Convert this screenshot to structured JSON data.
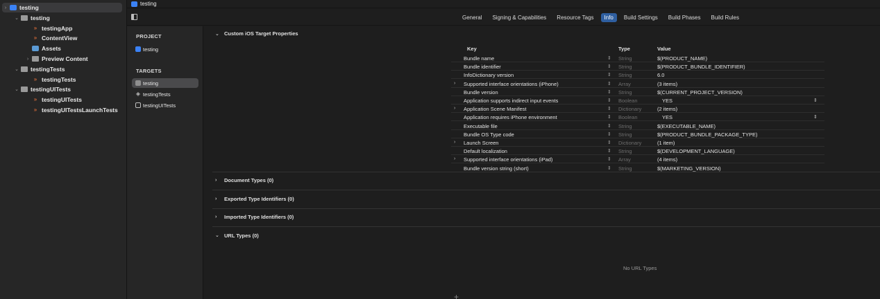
{
  "navigator": {
    "items": [
      {
        "label": "testing",
        "chevron": "›",
        "icon": "project-icon",
        "indent": 0,
        "selected": true
      },
      {
        "label": "testing",
        "chevron": "⌄",
        "icon": "folder-icon",
        "indent": 1
      },
      {
        "label": "testingApp",
        "chevron": "",
        "icon": "swift-file-icon",
        "indent": 2
      },
      {
        "label": "ContentView",
        "chevron": "",
        "icon": "swift-file-icon",
        "indent": 2
      },
      {
        "label": "Assets",
        "chevron": "",
        "icon": "asset-catalog-icon",
        "indent": 2
      },
      {
        "label": "Preview Content",
        "chevron": "›",
        "icon": "folder-icon",
        "indent": 2
      },
      {
        "label": "testingTests",
        "chevron": "⌄",
        "icon": "folder-icon",
        "indent": 1
      },
      {
        "label": "testingTests",
        "chevron": "",
        "icon": "swift-file-icon",
        "indent": 2
      },
      {
        "label": "testingUITests",
        "chevron": "⌄",
        "icon": "folder-icon",
        "indent": 1
      },
      {
        "label": "testingUITests",
        "chevron": "",
        "icon": "swift-file-icon",
        "indent": 2
      },
      {
        "label": "testingUITestsLaunchTests",
        "chevron": "",
        "icon": "swift-file-icon",
        "indent": 2
      }
    ]
  },
  "editor": {
    "breadcrumb": "testing",
    "tabs": [
      "General",
      "Signing & Capabilities",
      "Resource Tags",
      "Info",
      "Build Settings",
      "Build Phases",
      "Build Rules"
    ],
    "active_tab": "Info"
  },
  "targets_panel": {
    "project_header": "PROJECT",
    "project_name": "testing",
    "targets_header": "TARGETS",
    "targets": [
      "testing",
      "testingTests",
      "testingUITests"
    ]
  },
  "info": {
    "custom_properties_title": "Custom iOS Target Properties",
    "columns": {
      "key": "Key",
      "type": "Type",
      "value": "Value"
    },
    "rows": [
      {
        "key": "Bundle name",
        "type": "String",
        "value": "$(PRODUCT_NAME)",
        "expandable": false,
        "popup": false
      },
      {
        "key": "Bundle identifier",
        "type": "String",
        "value": "$(PRODUCT_BUNDLE_IDENTIFIER)",
        "expandable": false,
        "popup": false
      },
      {
        "key": "InfoDictionary version",
        "type": "String",
        "value": "6.0",
        "expandable": false,
        "popup": false
      },
      {
        "key": "Supported interface orientations (iPhone)",
        "type": "Array",
        "value": "(3 items)",
        "expandable": true,
        "popup": false
      },
      {
        "key": "Bundle version",
        "type": "String",
        "value": "$(CURRENT_PROJECT_VERSION)",
        "expandable": false,
        "popup": false
      },
      {
        "key": "Application supports indirect input events",
        "type": "Boolean",
        "value": "YES",
        "expandable": false,
        "popup": true
      },
      {
        "key": "Application Scene Manifest",
        "type": "Dictionary",
        "value": "(2 items)",
        "expandable": true,
        "popup": false
      },
      {
        "key": "Application requires iPhone environment",
        "type": "Boolean",
        "value": "YES",
        "expandable": false,
        "popup": true
      },
      {
        "key": "Executable file",
        "type": "String",
        "value": "$(EXECUTABLE_NAME)",
        "expandable": false,
        "popup": false
      },
      {
        "key": "Bundle OS Type code",
        "type": "String",
        "value": "$(PRODUCT_BUNDLE_PACKAGE_TYPE)",
        "expandable": false,
        "popup": false
      },
      {
        "key": "Launch Screen",
        "type": "Dictionary",
        "value": "(1 item)",
        "expandable": true,
        "popup": false
      },
      {
        "key": "Default localization",
        "type": "String",
        "value": "$(DEVELOPMENT_LANGUAGE)",
        "expandable": false,
        "popup": false
      },
      {
        "key": "Supported interface orientations (iPad)",
        "type": "Array",
        "value": "(4 items)",
        "expandable": true,
        "popup": false
      },
      {
        "key": "Bundle version string (short)",
        "type": "String",
        "value": "$(MARKETING_VERSION)",
        "expandable": false,
        "popup": false
      }
    ],
    "sections": [
      "Document Types (0)",
      "Exported Type Identifiers (0)",
      "Imported Type Identifiers (0)",
      "URL Types (0)"
    ],
    "empty_url_types": "No URL Types",
    "add_button": "+"
  },
  "colors": {
    "accent": "#2f5fa0",
    "background": "#1e1e1e",
    "sidebar": "#262626"
  }
}
